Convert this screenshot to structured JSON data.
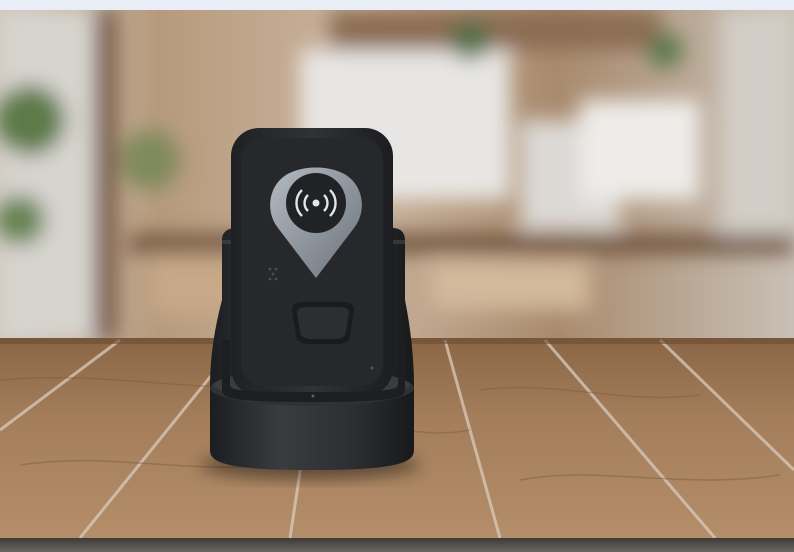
{
  "scene": {
    "subject": "handheld-rfid-reader-in-dock",
    "icons": {
      "device_emblem": "nfc-wireless-icon",
      "emblem_shape": "map-pin-shape"
    },
    "colors": {
      "device_body": "#2b2d31",
      "dock_body": "#26282b",
      "emblem_ring": "#8f969e",
      "tabletop_wood": "#9a7452",
      "background_wall": "#b9a48c",
      "top_bar": "#e9edf5"
    }
  }
}
